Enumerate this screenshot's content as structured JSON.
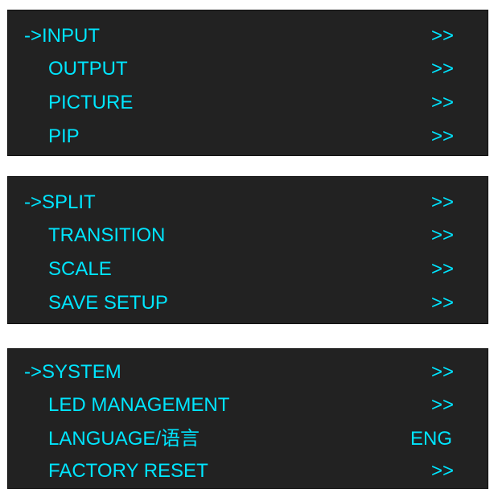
{
  "panels": [
    {
      "rows": [
        {
          "label": "->INPUT",
          "value": ">>"
        },
        {
          "label": "OUTPUT",
          "value": ">>"
        },
        {
          "label": "PICTURE",
          "value": ">>"
        },
        {
          "label": "PIP",
          "value": ">>"
        }
      ]
    },
    {
      "rows": [
        {
          "label": "->SPLIT",
          "value": ">>"
        },
        {
          "label": "TRANSITION",
          "value": ">>"
        },
        {
          "label": "SCALE",
          "value": ">>"
        },
        {
          "label": "SAVE SETUP",
          "value": ">>"
        }
      ]
    },
    {
      "rows": [
        {
          "label": "->SYSTEM",
          "value": ">>"
        },
        {
          "label": "LED MANAGEMENT",
          "value": ">>"
        },
        {
          "label": "LANGUAGE/语言",
          "value": "ENG"
        },
        {
          "label": "FACTORY RESET",
          "value": ">>"
        }
      ]
    }
  ],
  "colors": {
    "panel_background": "#222222",
    "text": "#00e5ff",
    "page_background": "#ffffff"
  }
}
